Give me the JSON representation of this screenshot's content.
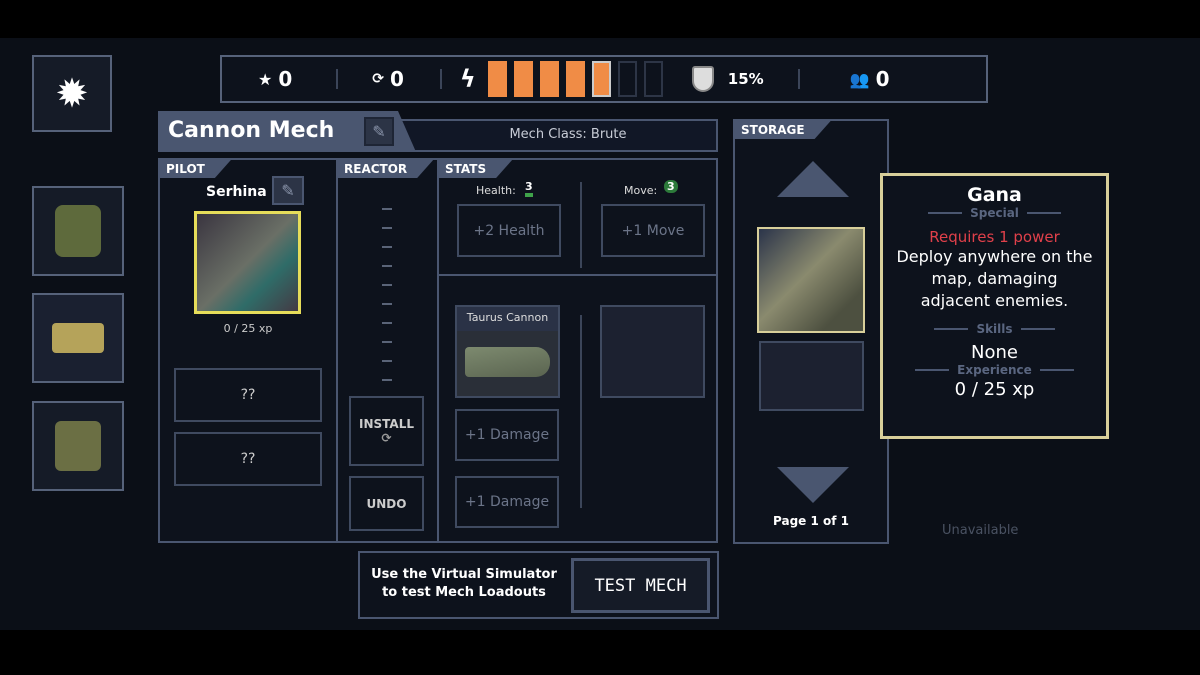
{
  "topbar": {
    "stars": "0",
    "reputation": "0",
    "power_filled": 5,
    "power_total": 7,
    "grid_defense": "15%",
    "pilots": "0"
  },
  "colors": {
    "power": "#f08c46",
    "accent_border": "#d8cf9a",
    "warning": "#e0404a"
  },
  "mech": {
    "name": "Cannon Mech",
    "class": "Mech Class: Brute"
  },
  "pilot": {
    "label": "PILOT",
    "name": "Serhina",
    "xp": "0 / 25 xp",
    "skills": [
      "??",
      "??"
    ]
  },
  "reactor": {
    "label": "REACTOR",
    "install": "INSTALL",
    "undo": "UNDO"
  },
  "stats": {
    "label": "STATS",
    "health_label": "Health:",
    "health": "3",
    "move_label": "Move:",
    "move": "3",
    "health_upgrade": "+2 Health",
    "move_upgrade": "+1 Move"
  },
  "weapon": {
    "name": "Taurus Cannon",
    "upgrades": [
      "+1 Damage",
      "+1 Damage"
    ]
  },
  "storage": {
    "label": "STORAGE",
    "page": "Page 1 of 1"
  },
  "tooltip": {
    "name": "Gana",
    "special_label": "Special",
    "requirement": "Requires 1 power",
    "description": "Deploy anywhere on the map, damaging adjacent enemies.",
    "skills_label": "Skills",
    "skills": "None",
    "experience_label": "Experience",
    "xp": "0 / 25 xp"
  },
  "simulator": {
    "text": "Use the Virtual Simulator to test Mech Loadouts",
    "button": "TEST MECH"
  },
  "map": {
    "status": "Unavailable"
  }
}
